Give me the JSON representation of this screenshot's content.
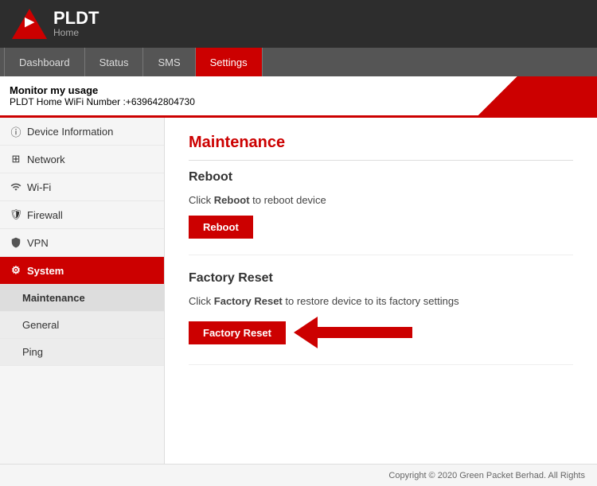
{
  "header": {
    "logo_text": "PLDT",
    "logo_subtext": "Home"
  },
  "navbar": {
    "items": [
      {
        "label": "Dashboard",
        "active": false
      },
      {
        "label": "Status",
        "active": false
      },
      {
        "label": "SMS",
        "active": false
      },
      {
        "label": "Settings",
        "active": true
      }
    ]
  },
  "info_bar": {
    "title": "Monitor my usage",
    "subtitle": "PLDT Home WiFi Number :+639642804730"
  },
  "sidebar": {
    "items": [
      {
        "label": "Device Information",
        "icon": "info-icon",
        "active": false,
        "sub": false
      },
      {
        "label": "Network",
        "icon": "network-icon",
        "active": false,
        "sub": false
      },
      {
        "label": "Wi-Fi",
        "icon": "wifi-icon",
        "active": false,
        "sub": false
      },
      {
        "label": "Firewall",
        "icon": "firewall-icon",
        "active": false,
        "sub": false
      },
      {
        "label": "VPN",
        "icon": "vpn-icon",
        "active": false,
        "sub": false
      },
      {
        "label": "System",
        "icon": "system-icon",
        "active": true,
        "sub": false
      },
      {
        "label": "Maintenance",
        "active": true,
        "sub": true
      },
      {
        "label": "General",
        "active": false,
        "sub": true
      },
      {
        "label": "Ping",
        "active": false,
        "sub": true
      }
    ]
  },
  "content": {
    "page_title": "Maintenance",
    "sections": [
      {
        "id": "reboot",
        "title": "Reboot",
        "description_prefix": "Click ",
        "description_bold": "Reboot",
        "description_suffix": " to reboot device",
        "button_label": "Reboot"
      },
      {
        "id": "factory-reset",
        "title": "Factory Reset",
        "description_prefix": "Click ",
        "description_bold": "Factory Reset",
        "description_suffix": " to restore device to its factory settings",
        "button_label": "Factory Reset",
        "has_arrow": true
      }
    ]
  },
  "footer": {
    "text": "Copyright © 2020 Green Packet Berhad. All Rights"
  },
  "colors": {
    "accent": "#cc0000",
    "dark": "#2d2d2d",
    "sidebar_active": "#cc0000"
  }
}
